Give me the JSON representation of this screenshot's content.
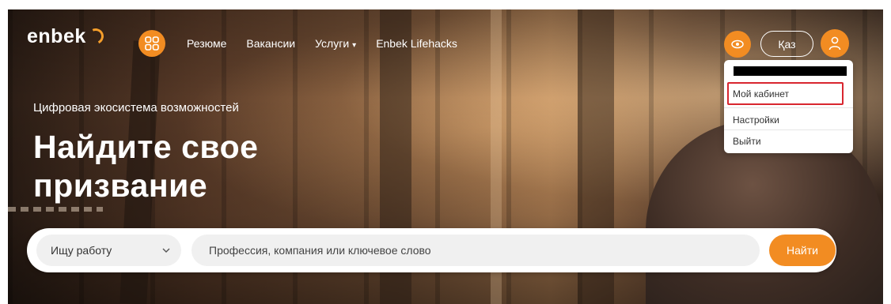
{
  "brand": {
    "logo_text": "enbek",
    "accent": "#f28c22"
  },
  "nav": {
    "items": [
      {
        "label": "Резюме"
      },
      {
        "label": "Вакансии"
      },
      {
        "label": "Услуги"
      },
      {
        "label": "Enbek Lifehacks"
      }
    ],
    "services_dropdown_icon": "chevron-down-icon"
  },
  "header": {
    "accessibility_icon": "eye-icon",
    "apps_icon": "grid-icon",
    "language_label": "Қаз",
    "user_icon": "user-icon"
  },
  "user_menu": {
    "items": [
      {
        "label": "Мой кабинет"
      },
      {
        "label": "Настройки"
      },
      {
        "label": "Выйти"
      }
    ],
    "highlight_color": "#d8262f"
  },
  "hero": {
    "tagline": "Цифровая экосистема возможностей",
    "headline_line1": "Найдите свое",
    "headline_line2": "призвание"
  },
  "search": {
    "type_value": "Ищу работу",
    "placeholder": "Профессия, компания или ключевое слово",
    "button_label": "Найти"
  }
}
